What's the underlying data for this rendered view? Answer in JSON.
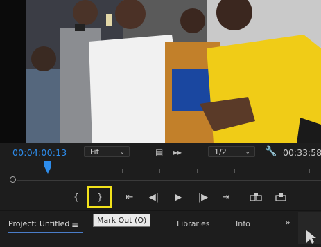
{
  "program_monitor": {
    "current_timecode": "00:04:00:13",
    "duration_timecode": "00:33:58",
    "zoom": {
      "value": "Fit"
    },
    "resolution": {
      "value": "1/2"
    }
  },
  "transport": {
    "buttons": [
      {
        "name": "mark-in-button",
        "icon": "{"
      },
      {
        "name": "mark-out-button",
        "icon": "}",
        "highlighted": true
      },
      {
        "name": "go-to-in-button",
        "icon": "⇤"
      },
      {
        "name": "step-back-button",
        "icon": "◀|"
      },
      {
        "name": "play-button",
        "icon": "▶"
      },
      {
        "name": "step-forward-button",
        "icon": "|▶"
      },
      {
        "name": "go-to-out-button",
        "icon": "⇥"
      },
      {
        "name": "insert-button",
        "icon": "insert"
      },
      {
        "name": "overwrite-button",
        "icon": "overwrite"
      }
    ],
    "tooltip": "Mark Out (O)"
  },
  "panel": {
    "tabs": [
      "Project: Untitled",
      "Libraries",
      "Info"
    ],
    "active_tab": "Project: Untitled"
  },
  "colors": {
    "accent_blue": "#2d8ceb",
    "highlight_yellow": "#f2e21b",
    "background": "#1d1d1d"
  }
}
